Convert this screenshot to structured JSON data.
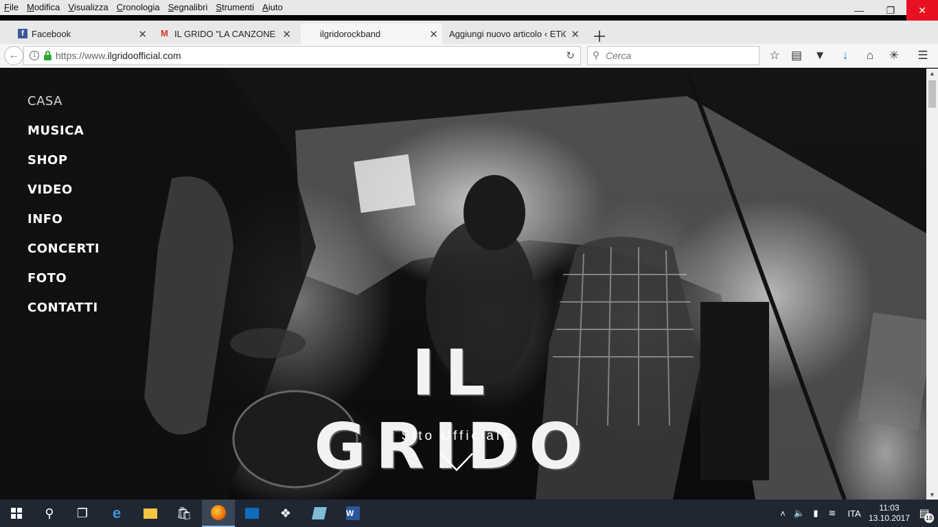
{
  "menubar": {
    "items": [
      "File",
      "Modifica",
      "Visualizza",
      "Cronologia",
      "Segnalibri",
      "Strumenti",
      "Aiuto"
    ]
  },
  "tabs": [
    {
      "label": "Facebook",
      "icon": "facebook-icon",
      "active": false
    },
    {
      "label": "IL GRIDO \"LA CANZONE DI ",
      "icon": "gmail-icon",
      "active": false
    },
    {
      "label": "ilgridorockband",
      "icon": "",
      "active": true
    },
    {
      "label": "Aggiungi nuovo articolo ‹ ETiCi",
      "icon": "",
      "active": false
    }
  ],
  "navbar": {
    "url_scheme": "https://www.",
    "url_host": "ilgridoofficial.com",
    "search_placeholder": "Cerca"
  },
  "site": {
    "nav": [
      "CASA",
      "MUSICA",
      "SHOP",
      "VIDEO",
      "INFO",
      "CONCERTI",
      "FOTO",
      "CONTATTI"
    ],
    "title": "IL GRIDO",
    "subtitle": "Sito Ufficiale"
  },
  "taskbar": {
    "apps": [
      "start-icon",
      "search-icon",
      "task-view-icon",
      "edge-icon",
      "file-explorer-icon",
      "store-icon",
      "firefox-icon",
      "outlook-icon",
      "dropbox-icon",
      "notepad-icon",
      "word-icon"
    ],
    "language": "ITA",
    "time": "11:03",
    "date": "13.10.2017",
    "notifications": "18"
  },
  "colors": {
    "close_button": "#e81123",
    "lock": "#2ea836",
    "download_arrow": "#0a84ff",
    "taskbar": "#1f2733"
  }
}
